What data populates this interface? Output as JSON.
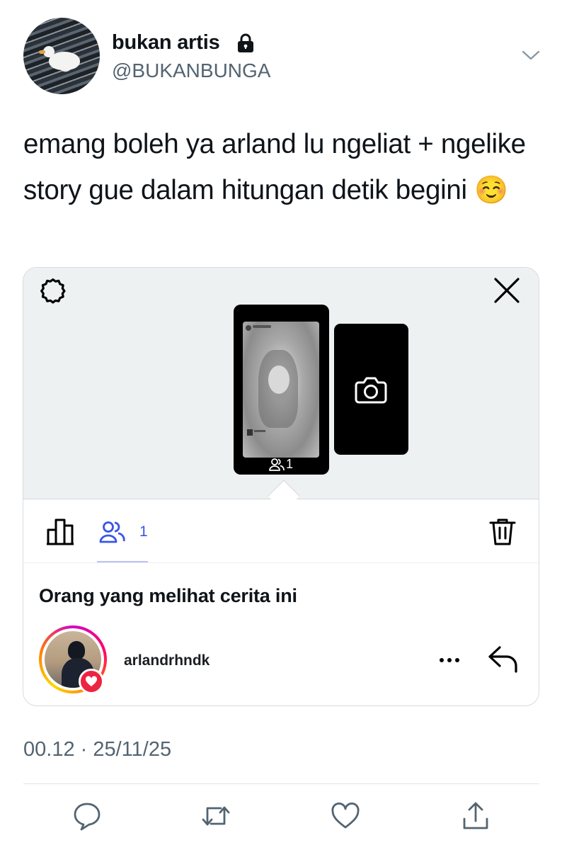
{
  "user": {
    "display_name": "bukan artis",
    "handle": "@BUKANBUNGA",
    "protected_icon": "lock-icon"
  },
  "tweet": {
    "text": "emang boleh ya arland lu ngeliat + ngelike story gue dalam hitungan detik begini ☺️",
    "timestamp": "00.12 · 25/11/25"
  },
  "embedded_screenshot": {
    "story_viewer_count": "1",
    "viewers_tab_count": "1",
    "list_heading": "Orang yang melihat cerita ini",
    "viewers": [
      {
        "username": "arlandrhndk",
        "liked": true
      }
    ],
    "icons": [
      "settings-icon",
      "close-icon",
      "camera-icon",
      "insights-icon",
      "viewers-icon",
      "trash-icon",
      "more-icon",
      "reply-icon"
    ],
    "colors": {
      "accent": "#3b55e6",
      "like": "#ed2342"
    }
  },
  "actions": [
    "reply-icon",
    "retweet-icon",
    "like-icon",
    "share-icon"
  ]
}
